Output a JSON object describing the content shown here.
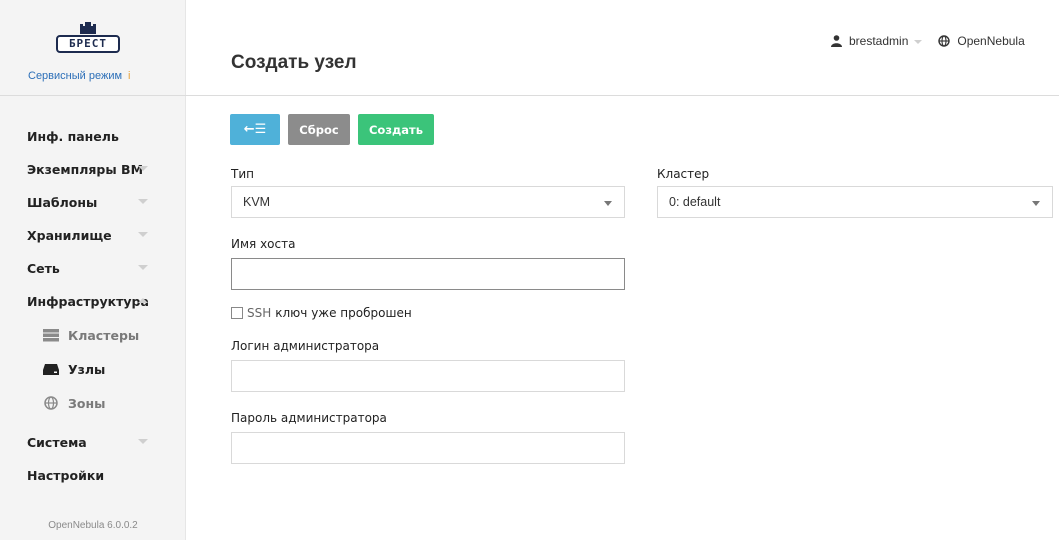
{
  "sidebar": {
    "logo_text": "БРЕСТ",
    "service_mode": "Сервисный режим",
    "service_mode_info": "i",
    "items": [
      {
        "label": "Инф. панель"
      },
      {
        "label": "Экземпляры ВМ"
      },
      {
        "label": "Шаблоны"
      },
      {
        "label": "Хранилище"
      },
      {
        "label": "Сеть"
      },
      {
        "label": "Инфраструктура"
      }
    ],
    "subitems": [
      {
        "label": "Кластеры",
        "icon": "server-stack-icon"
      },
      {
        "label": "Узлы",
        "icon": "host-drive-icon"
      },
      {
        "label": "Зоны",
        "icon": "globe-icon"
      }
    ],
    "bottom_items": [
      {
        "label": "Система"
      },
      {
        "label": "Настройки"
      }
    ],
    "version": "OpenNebula 6.0.0.2"
  },
  "header": {
    "title": "Создать узел",
    "user": "brestadmin",
    "zone": "OpenNebula"
  },
  "toolbar": {
    "back_label": "←☰",
    "reset_label": "Сброс",
    "create_label": "Создать"
  },
  "form": {
    "type_label": "Тип",
    "type_value": "KVM",
    "cluster_label": "Кластер",
    "cluster_value": "0: default",
    "hostname_label": "Имя хоста",
    "hostname_value": "",
    "ssh_label_prefix": "SSH",
    "ssh_label_rest": "ключ уже проброшен",
    "admin_login_label": "Логин администратора",
    "admin_login_value": "",
    "admin_password_label": "Пароль администратора",
    "admin_password_value": ""
  },
  "colors": {
    "back_button": "#4fb1d9",
    "reset_button": "#8c8c8c",
    "create_button": "#3bc47a",
    "service_mode": "#2c6fb8"
  }
}
